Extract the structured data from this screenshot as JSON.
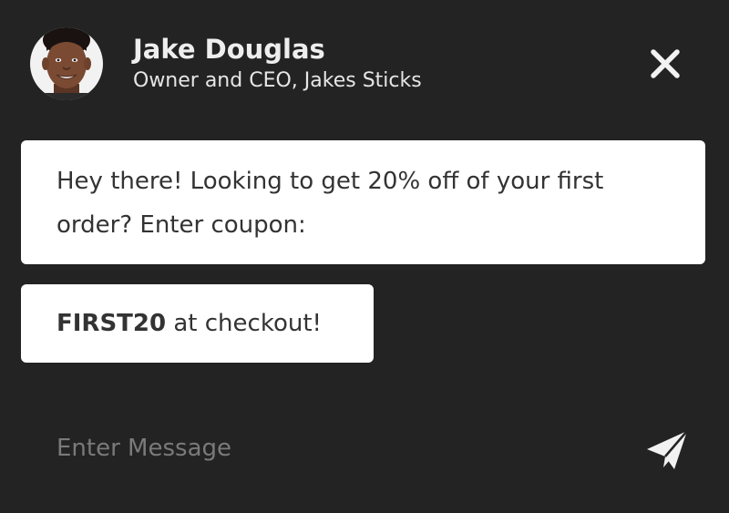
{
  "header": {
    "name": "Jake Douglas",
    "role": "Owner and CEO, Jakes Sticks",
    "avatar_icon": "person-photo",
    "close_icon": "close-icon"
  },
  "messages": [
    {
      "text": "Hey there! Looking to get 20% off of your first order? Enter coupon:"
    },
    {
      "code": "FIRST20",
      "suffix": " at checkout!"
    }
  ],
  "composer": {
    "placeholder": "Enter Message",
    "value": "",
    "send_icon": "paper-plane-icon"
  },
  "colors": {
    "background": "#232323",
    "bubble": "#ffffff",
    "bubble_text": "#333333",
    "header_text": "#eeeeee",
    "placeholder": "#7a7a7a"
  }
}
